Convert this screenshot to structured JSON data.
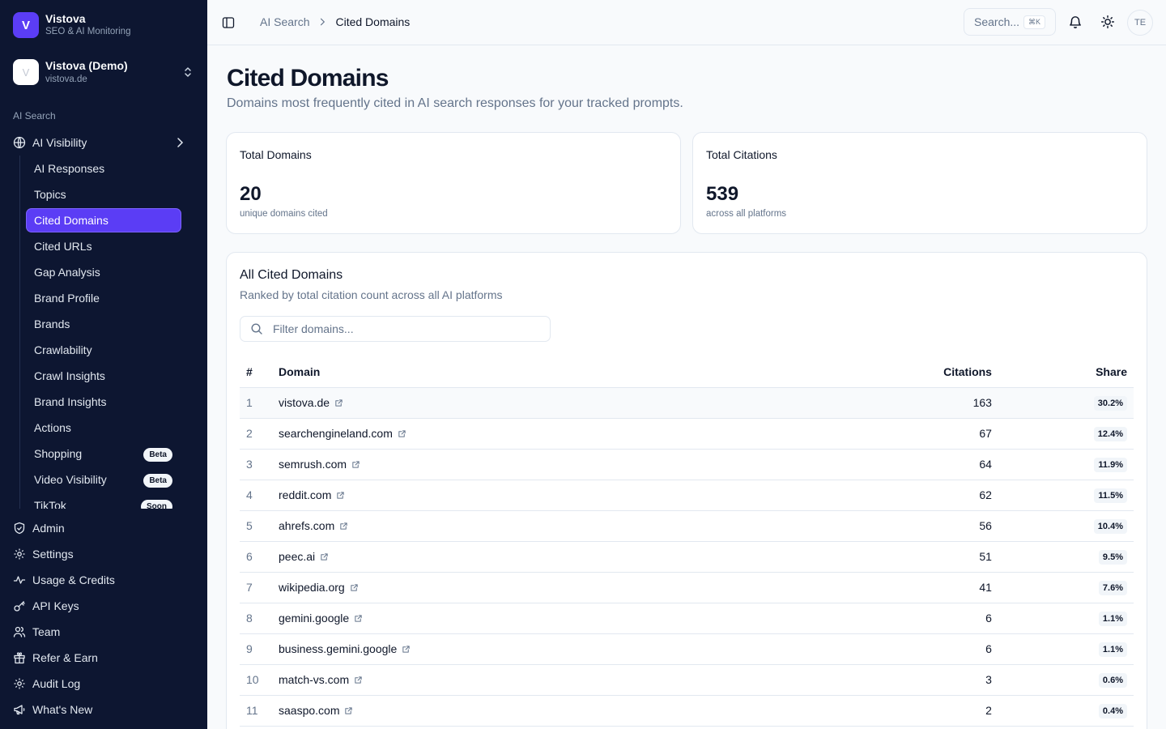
{
  "app": {
    "name": "Vistova",
    "subtitle": "SEO & AI Monitoring",
    "logo_letter": "V"
  },
  "project": {
    "name": "Vistova (Demo)",
    "domain": "vistova.de",
    "avatar_letter": "V"
  },
  "sidebar": {
    "section_label": "AI Search",
    "ai_visibility_label": "AI Visibility",
    "sub_items": [
      {
        "label": "AI Responses"
      },
      {
        "label": "Topics"
      },
      {
        "label": "Cited Domains",
        "active": true
      },
      {
        "label": "Cited URLs"
      },
      {
        "label": "Gap Analysis"
      },
      {
        "label": "Brand Profile"
      },
      {
        "label": "Brands"
      },
      {
        "label": "Crawlability"
      },
      {
        "label": "Crawl Insights"
      },
      {
        "label": "Brand Insights"
      },
      {
        "label": "Actions"
      },
      {
        "label": "Shopping",
        "badge": "Beta"
      },
      {
        "label": "Video Visibility",
        "badge": "Beta"
      },
      {
        "label": "TikTok",
        "badge": "Soon"
      }
    ],
    "bottom_items": [
      {
        "label": "Admin",
        "icon": "shield-icon"
      },
      {
        "label": "Settings",
        "icon": "gear-icon"
      },
      {
        "label": "Usage & Credits",
        "icon": "activity-icon"
      },
      {
        "label": "API Keys",
        "icon": "key-icon"
      },
      {
        "label": "Team",
        "icon": "users-icon"
      },
      {
        "label": "Refer & Earn",
        "icon": "gift-icon"
      },
      {
        "label": "Audit Log",
        "icon": "gear-icon"
      },
      {
        "label": "What's New",
        "icon": "megaphone-icon"
      }
    ]
  },
  "header": {
    "breadcrumb": [
      "AI Search",
      "Cited Domains"
    ],
    "search_label": "Search...",
    "search_shortcut": "⌘K",
    "avatar_initials": "TE"
  },
  "page": {
    "title": "Cited Domains",
    "subtitle": "Domains most frequently cited in AI search responses for your tracked prompts."
  },
  "stats": {
    "total_domains": {
      "label": "Total Domains",
      "value": "20",
      "note": "unique domains cited"
    },
    "total_citations": {
      "label": "Total Citations",
      "value": "539",
      "note": "across all platforms"
    }
  },
  "table_card": {
    "title": "All Cited Domains",
    "subtitle": "Ranked by total citation count across all AI platforms",
    "filter_placeholder": "Filter domains...",
    "columns": {
      "rank": "#",
      "domain": "Domain",
      "citations": "Citations",
      "share": "Share"
    },
    "rows": [
      {
        "rank": "1",
        "domain": "vistova.de",
        "citations": "163",
        "share": "30.2%"
      },
      {
        "rank": "2",
        "domain": "searchengineland.com",
        "citations": "67",
        "share": "12.4%"
      },
      {
        "rank": "3",
        "domain": "semrush.com",
        "citations": "64",
        "share": "11.9%"
      },
      {
        "rank": "4",
        "domain": "reddit.com",
        "citations": "62",
        "share": "11.5%"
      },
      {
        "rank": "5",
        "domain": "ahrefs.com",
        "citations": "56",
        "share": "10.4%"
      },
      {
        "rank": "6",
        "domain": "peec.ai",
        "citations": "51",
        "share": "9.5%"
      },
      {
        "rank": "7",
        "domain": "wikipedia.org",
        "citations": "41",
        "share": "7.6%"
      },
      {
        "rank": "8",
        "domain": "gemini.google",
        "citations": "6",
        "share": "1.1%"
      },
      {
        "rank": "9",
        "domain": "business.gemini.google",
        "citations": "6",
        "share": "1.1%"
      },
      {
        "rank": "10",
        "domain": "match-vs.com",
        "citations": "3",
        "share": "0.6%"
      },
      {
        "rank": "11",
        "domain": "saaspo.com",
        "citations": "2",
        "share": "0.4%"
      }
    ]
  }
}
